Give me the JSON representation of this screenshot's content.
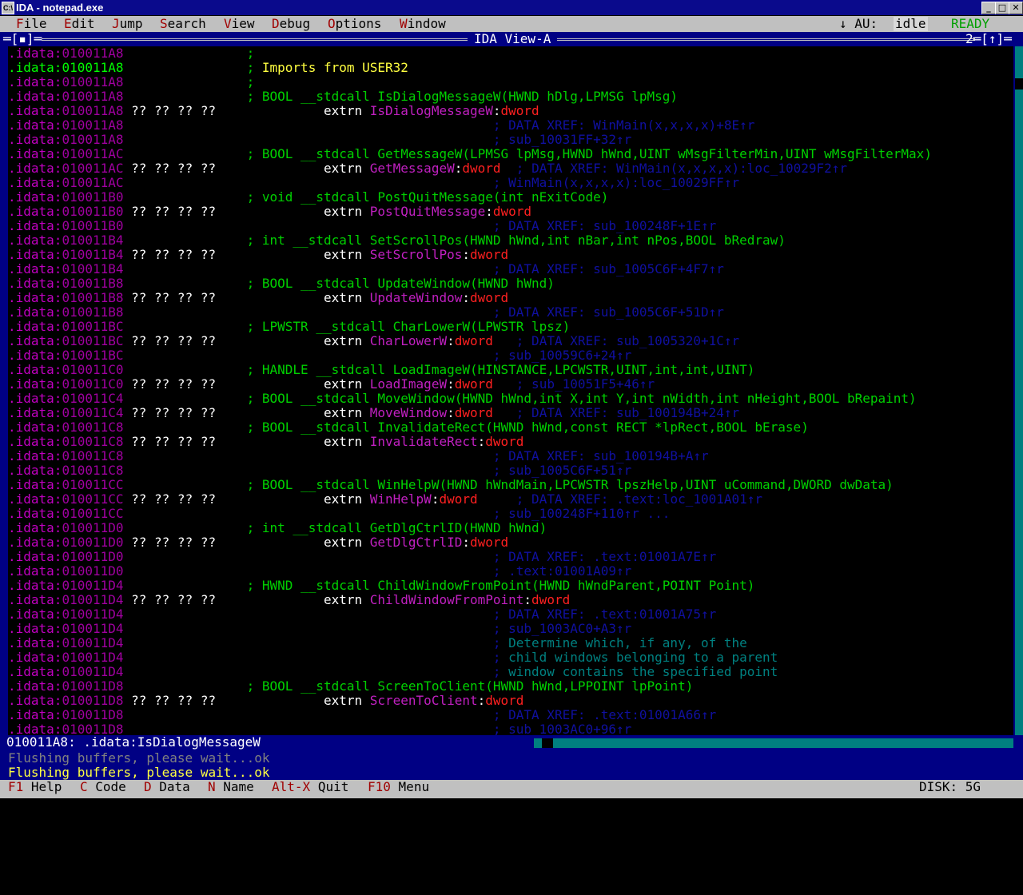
{
  "window": {
    "title": "IDA - notepad.exe",
    "icon": "C:\\"
  },
  "menu": [
    {
      "hk": "F",
      "rest": "ile"
    },
    {
      "hk": "E",
      "rest": "dit"
    },
    {
      "hk": "J",
      "rest": "ump"
    },
    {
      "hk": "S",
      "rest": "earch"
    },
    {
      "hk": "V",
      "rest": "iew"
    },
    {
      "hk": "D",
      "rest": "ebug"
    },
    {
      "hk": "O",
      "rest": "ptions"
    },
    {
      "hk": "W",
      "rest": "indow"
    }
  ],
  "autoanalysis": {
    "arrow": "↓",
    "label": "AU:",
    "state": "idle",
    "status": "READY"
  },
  "view": {
    "title": "IDA View-A",
    "close": "═[▪]═",
    "num": "2═[↑]═"
  },
  "listing": [
    {
      "addr": "010011A8",
      "parts": [
        {
          "t": "                ; ",
          "c": "cmt"
        }
      ]
    },
    {
      "addr": "010011A8",
      "cur": true,
      "parts": [
        {
          "t": "                ; ",
          "c": "cmt"
        },
        {
          "t": "Imports from USER32",
          "c": "yel"
        }
      ]
    },
    {
      "addr": "010011A8",
      "parts": [
        {
          "t": "                ; ",
          "c": "cmt"
        }
      ]
    },
    {
      "addr": "010011A8",
      "parts": [
        {
          "t": "                ; BOOL __stdcall IsDialogMessageW(HWND hDlg,LPMSG lpMsg)",
          "c": "cmt"
        }
      ]
    },
    {
      "addr": "010011A8",
      "parts": [
        {
          "t": " ?? ?? ?? ??",
          "c": "bytes"
        },
        {
          "t": "              extrn ",
          "c": "kw"
        },
        {
          "t": "IsDialogMessageW",
          "c": "nm"
        },
        {
          "t": ":",
          "c": "kw"
        },
        {
          "t": "dword",
          "c": "tp"
        }
      ]
    },
    {
      "addr": "010011A8",
      "parts": [
        {
          "t": "                                                ; DATA XREF: WinMain(x,x,x,x)+8E↑r",
          "c": "xr"
        }
      ]
    },
    {
      "addr": "010011A8",
      "parts": [
        {
          "t": "                                                ; sub_10031FF+32↑r",
          "c": "xr"
        }
      ]
    },
    {
      "addr": "010011AC",
      "parts": [
        {
          "t": "                ; BOOL __stdcall GetMessageW(LPMSG lpMsg,HWND hWnd,UINT wMsgFilterMin,UINT wMsgFilterMax)",
          "c": "cmt"
        }
      ]
    },
    {
      "addr": "010011AC",
      "parts": [
        {
          "t": " ?? ?? ?? ??",
          "c": "bytes"
        },
        {
          "t": "              extrn ",
          "c": "kw"
        },
        {
          "t": "GetMessageW",
          "c": "nm"
        },
        {
          "t": ":",
          "c": "kw"
        },
        {
          "t": "dword",
          "c": "tp"
        },
        {
          "t": "  ; DATA XREF: WinMain(x,x,x,x):loc_10029F2↑r",
          "c": "xr"
        }
      ]
    },
    {
      "addr": "010011AC",
      "parts": [
        {
          "t": "                                                ; WinMain(x,x,x,x):loc_10029FF↑r",
          "c": "xr"
        }
      ]
    },
    {
      "addr": "010011B0",
      "parts": [
        {
          "t": "                ; void __stdcall PostQuitMessage(int nExitCode)",
          "c": "cmt"
        }
      ]
    },
    {
      "addr": "010011B0",
      "parts": [
        {
          "t": " ?? ?? ?? ??",
          "c": "bytes"
        },
        {
          "t": "              extrn ",
          "c": "kw"
        },
        {
          "t": "PostQuitMessage",
          "c": "nm"
        },
        {
          "t": ":",
          "c": "kw"
        },
        {
          "t": "dword",
          "c": "tp"
        }
      ]
    },
    {
      "addr": "010011B0",
      "parts": [
        {
          "t": "                                                ; DATA XREF: sub_100248F+1E↑r",
          "c": "xr"
        }
      ]
    },
    {
      "addr": "010011B4",
      "parts": [
        {
          "t": "                ; int __stdcall SetScrollPos(HWND hWnd,int nBar,int nPos,BOOL bRedraw)",
          "c": "cmt"
        }
      ]
    },
    {
      "addr": "010011B4",
      "parts": [
        {
          "t": " ?? ?? ?? ??",
          "c": "bytes"
        },
        {
          "t": "              extrn ",
          "c": "kw"
        },
        {
          "t": "SetScrollPos",
          "c": "nm"
        },
        {
          "t": ":",
          "c": "kw"
        },
        {
          "t": "dword",
          "c": "tp"
        }
      ]
    },
    {
      "addr": "010011B4",
      "parts": [
        {
          "t": "                                                ; DATA XREF: sub_1005C6F+4F7↑r",
          "c": "xr"
        }
      ]
    },
    {
      "addr": "010011B8",
      "parts": [
        {
          "t": "                ; BOOL __stdcall UpdateWindow(HWND hWnd)",
          "c": "cmt"
        }
      ]
    },
    {
      "addr": "010011B8",
      "parts": [
        {
          "t": " ?? ?? ?? ??",
          "c": "bytes"
        },
        {
          "t": "              extrn ",
          "c": "kw"
        },
        {
          "t": "UpdateWindow",
          "c": "nm"
        },
        {
          "t": ":",
          "c": "kw"
        },
        {
          "t": "dword",
          "c": "tp"
        }
      ]
    },
    {
      "addr": "010011B8",
      "parts": [
        {
          "t": "                                                ; DATA XREF: sub_1005C6F+51D↑r",
          "c": "xr"
        }
      ]
    },
    {
      "addr": "010011BC",
      "parts": [
        {
          "t": "                ; LPWSTR __stdcall CharLowerW(LPWSTR lpsz)",
          "c": "cmt"
        }
      ]
    },
    {
      "addr": "010011BC",
      "parts": [
        {
          "t": " ?? ?? ?? ??",
          "c": "bytes"
        },
        {
          "t": "              extrn ",
          "c": "kw"
        },
        {
          "t": "CharLowerW",
          "c": "nm"
        },
        {
          "t": ":",
          "c": "kw"
        },
        {
          "t": "dword",
          "c": "tp"
        },
        {
          "t": "   ; DATA XREF: sub_1005320+1C↑r",
          "c": "xr"
        }
      ]
    },
    {
      "addr": "010011BC",
      "parts": [
        {
          "t": "                                                ; sub_10059C6+24↑r",
          "c": "xr"
        }
      ]
    },
    {
      "addr": "010011C0",
      "parts": [
        {
          "t": "                ; HANDLE __stdcall LoadImageW(HINSTANCE,LPCWSTR,UINT,int,int,UINT)",
          "c": "cmt"
        }
      ]
    },
    {
      "addr": "010011C0",
      "parts": [
        {
          "t": " ?? ?? ?? ??",
          "c": "bytes"
        },
        {
          "t": "              extrn ",
          "c": "kw"
        },
        {
          "t": "LoadImageW",
          "c": "nm"
        },
        {
          "t": ":",
          "c": "kw"
        },
        {
          "t": "dword",
          "c": "tp"
        },
        {
          "t": "   ; sub_10051F5+46↑r",
          "c": "xr"
        }
      ]
    },
    {
      "addr": "010011C4",
      "parts": [
        {
          "t": "                ; BOOL __stdcall MoveWindow(HWND hWnd,int X,int Y,int nWidth,int nHeight,BOOL bRepaint)",
          "c": "cmt"
        }
      ]
    },
    {
      "addr": "010011C4",
      "parts": [
        {
          "t": " ?? ?? ?? ??",
          "c": "bytes"
        },
        {
          "t": "              extrn ",
          "c": "kw"
        },
        {
          "t": "MoveWindow",
          "c": "nm"
        },
        {
          "t": ":",
          "c": "kw"
        },
        {
          "t": "dword",
          "c": "tp"
        },
        {
          "t": "   ; DATA XREF: sub_100194B+24↑r",
          "c": "xr"
        }
      ]
    },
    {
      "addr": "010011C8",
      "parts": [
        {
          "t": "                ; BOOL __stdcall InvalidateRect(HWND hWnd,const RECT *lpRect,BOOL bErase)",
          "c": "cmt"
        }
      ]
    },
    {
      "addr": "010011C8",
      "parts": [
        {
          "t": " ?? ?? ?? ??",
          "c": "bytes"
        },
        {
          "t": "              extrn ",
          "c": "kw"
        },
        {
          "t": "InvalidateRect",
          "c": "nm"
        },
        {
          "t": ":",
          "c": "kw"
        },
        {
          "t": "dword",
          "c": "tp"
        }
      ]
    },
    {
      "addr": "010011C8",
      "parts": [
        {
          "t": "                                                ; DATA XREF: sub_100194B+A↑r",
          "c": "xr"
        }
      ]
    },
    {
      "addr": "010011C8",
      "parts": [
        {
          "t": "                                                ; sub_1005C6F+51↑r",
          "c": "xr"
        }
      ]
    },
    {
      "addr": "010011CC",
      "parts": [
        {
          "t": "                ; BOOL __stdcall WinHelpW(HWND hWndMain,LPCWSTR lpszHelp,UINT uCommand,DWORD dwData)",
          "c": "cmt"
        }
      ]
    },
    {
      "addr": "010011CC",
      "parts": [
        {
          "t": " ?? ?? ?? ??",
          "c": "bytes"
        },
        {
          "t": "              extrn ",
          "c": "kw"
        },
        {
          "t": "WinHelpW",
          "c": "nm"
        },
        {
          "t": ":",
          "c": "kw"
        },
        {
          "t": "dword",
          "c": "tp"
        },
        {
          "t": "     ; DATA XREF: .text:loc_1001A01↑r",
          "c": "xr"
        }
      ]
    },
    {
      "addr": "010011CC",
      "parts": [
        {
          "t": "                                                ; sub_100248F+110↑r ...",
          "c": "xr"
        }
      ]
    },
    {
      "addr": "010011D0",
      "parts": [
        {
          "t": "                ; int __stdcall GetDlgCtrlID(HWND hWnd)",
          "c": "cmt"
        }
      ]
    },
    {
      "addr": "010011D0",
      "parts": [
        {
          "t": " ?? ?? ?? ??",
          "c": "bytes"
        },
        {
          "t": "              extrn ",
          "c": "kw"
        },
        {
          "t": "GetDlgCtrlID",
          "c": "nm"
        },
        {
          "t": ":",
          "c": "kw"
        },
        {
          "t": "dword",
          "c": "tp"
        }
      ]
    },
    {
      "addr": "010011D0",
      "parts": [
        {
          "t": "                                                ; DATA XREF: .text:01001A7E↑r",
          "c": "xr"
        }
      ]
    },
    {
      "addr": "010011D0",
      "parts": [
        {
          "t": "                                                ; .text:01001A09↑r",
          "c": "xr"
        }
      ]
    },
    {
      "addr": "010011D4",
      "parts": [
        {
          "t": "                ; HWND __stdcall ChildWindowFromPoint(HWND hWndParent,POINT Point)",
          "c": "cmt"
        }
      ]
    },
    {
      "addr": "010011D4",
      "parts": [
        {
          "t": " ?? ?? ?? ??",
          "c": "bytes"
        },
        {
          "t": "              extrn ",
          "c": "kw"
        },
        {
          "t": "ChildWindowFromPoint",
          "c": "nm"
        },
        {
          "t": ":",
          "c": "kw"
        },
        {
          "t": "dword",
          "c": "tp"
        }
      ]
    },
    {
      "addr": "010011D4",
      "parts": [
        {
          "t": "                                                ; DATA XREF: .text:01001A75↑r",
          "c": "xr"
        }
      ]
    },
    {
      "addr": "010011D4",
      "parts": [
        {
          "t": "                                                ; sub_1003AC0+A3↑r",
          "c": "xr"
        }
      ]
    },
    {
      "addr": "010011D4",
      "parts": [
        {
          "t": "                                                ; ",
          "c": "xr"
        },
        {
          "t": "Determine which, if any, of the",
          "c": "cyan"
        }
      ]
    },
    {
      "addr": "010011D4",
      "parts": [
        {
          "t": "                                                ; ",
          "c": "xr"
        },
        {
          "t": "child windows belonging to a parent",
          "c": "cyan"
        }
      ]
    },
    {
      "addr": "010011D4",
      "parts": [
        {
          "t": "                                                ; ",
          "c": "xr"
        },
        {
          "t": "window contains the specified point",
          "c": "cyan"
        }
      ]
    },
    {
      "addr": "010011D8",
      "parts": [
        {
          "t": "                ; BOOL __stdcall ScreenToClient(HWND hWnd,LPPOINT lpPoint)",
          "c": "cmt"
        }
      ]
    },
    {
      "addr": "010011D8",
      "parts": [
        {
          "t": " ?? ?? ?? ??",
          "c": "bytes"
        },
        {
          "t": "              extrn ",
          "c": "kw"
        },
        {
          "t": "ScreenToClient",
          "c": "nm"
        },
        {
          "t": ":",
          "c": "kw"
        },
        {
          "t": "dword",
          "c": "tp"
        }
      ]
    },
    {
      "addr": "010011D8",
      "parts": [
        {
          "t": "                                                ; DATA XREF: .text:01001A66↑r",
          "c": "xr"
        }
      ]
    },
    {
      "addr": "010011D8",
      "parts": [
        {
          "t": "                                                ; sub_1003AC0+96↑r",
          "c": "xr"
        }
      ]
    }
  ],
  "status_line": "010011A8: .idata:IsDialogMessageW",
  "messages": [
    "Flushing buffers, please wait...ok",
    "Flushing buffers, please wait...ok"
  ],
  "fkeys": [
    {
      "key": "F1",
      "label": "Help"
    },
    {
      "key": "C",
      "label": "Code"
    },
    {
      "key": "D",
      "label": "Data"
    },
    {
      "key": "N",
      "label": "Name"
    },
    {
      "key": "Alt-X",
      "label": "Quit"
    },
    {
      "key": "F10",
      "label": "Menu"
    }
  ],
  "disk": "DISK: 5G"
}
